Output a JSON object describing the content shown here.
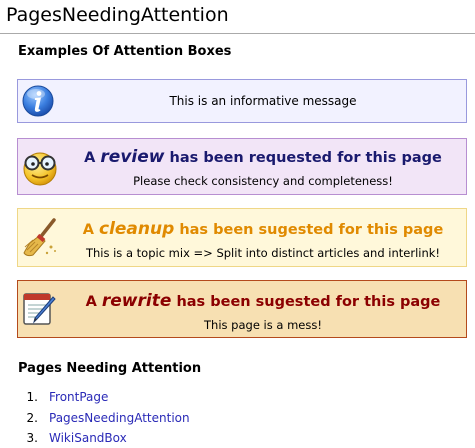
{
  "page": {
    "title": "PagesNeedingAttention"
  },
  "examples": {
    "heading": "Examples Of Attention Boxes",
    "info": {
      "icon": "info-icon",
      "message": "This is an informative message",
      "color": "#f2f2ff"
    },
    "review": {
      "icon": "glasses-smiley-icon",
      "prefix": "A ",
      "keyword": "review",
      "suffix": " has been requested for this page",
      "message": "Please check consistency and completeness!",
      "color": "#1a1a6e"
    },
    "cleanup": {
      "icon": "broom-icon",
      "prefix": "A ",
      "keyword": "cleanup",
      "suffix": " has been sugested for this page",
      "message": "This is a topic mix => Split into distinct articles and interlink!",
      "color": "#e08a00"
    },
    "rewrite": {
      "icon": "edit-document-icon",
      "prefix": "A ",
      "keyword": "rewrite",
      "suffix": " has been sugested for this page",
      "message": "This page is a mess!",
      "color": "#8b0000"
    }
  },
  "pages_needing_attention": {
    "heading": "Pages Needing Attention",
    "items": [
      {
        "number": "1.",
        "label": "FrontPage"
      },
      {
        "number": "2.",
        "label": "PagesNeedingAttention"
      },
      {
        "number": "3.",
        "label": "WikiSandBox"
      }
    ]
  }
}
